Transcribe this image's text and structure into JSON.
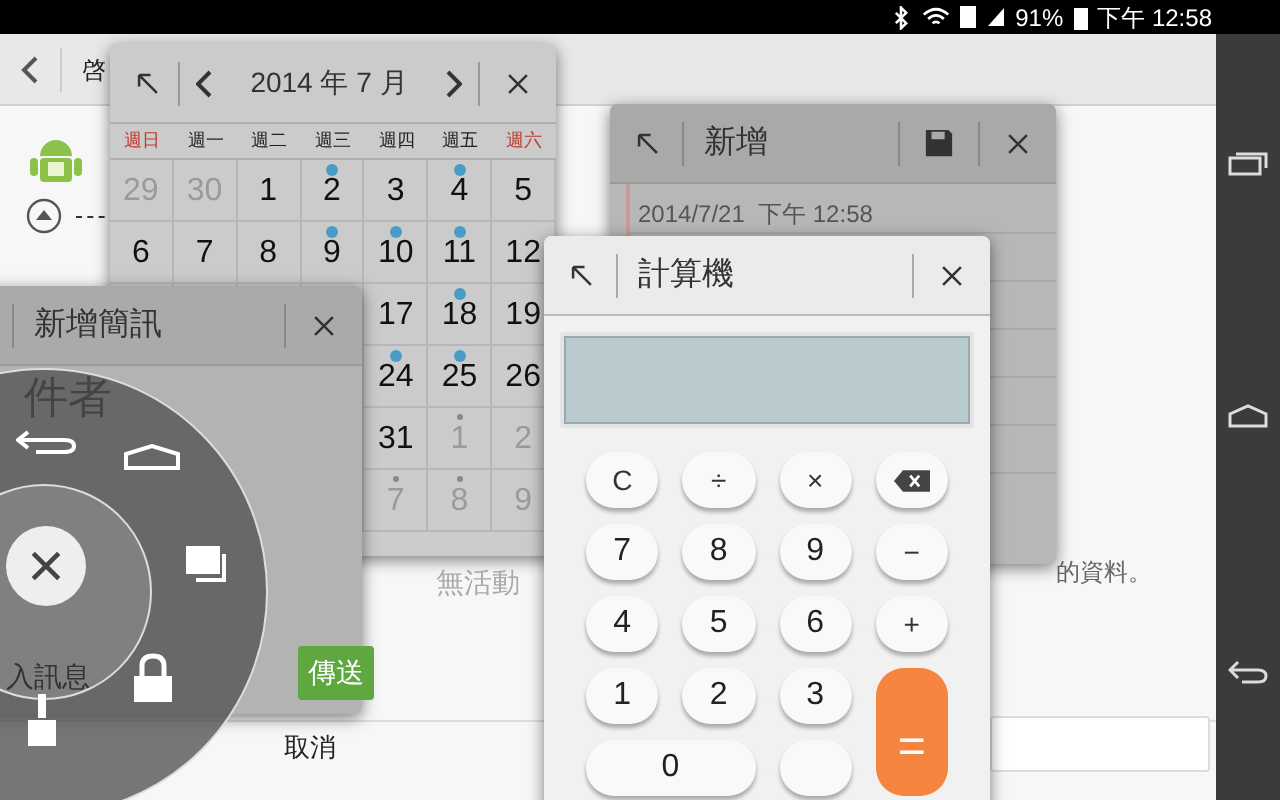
{
  "status_bar": {
    "battery": "91%",
    "time": "下午 12:58"
  },
  "background_app": {
    "title": "啓",
    "texts": [
      "無活動",
      "的資料。"
    ],
    "cancel_button": "取消"
  },
  "calendar_window": {
    "title": "2014 年 7 月",
    "weekdays": [
      {
        "label": "週日",
        "weekend": true
      },
      {
        "label": "週一",
        "weekend": false
      },
      {
        "label": "週二",
        "weekend": false
      },
      {
        "label": "週三",
        "weekend": false
      },
      {
        "label": "週四",
        "weekend": false
      },
      {
        "label": "週五",
        "weekend": false
      },
      {
        "label": "週六",
        "weekend": true
      }
    ],
    "weeks": [
      [
        {
          "day": "29",
          "muted": true,
          "event": false,
          "minor": false
        },
        {
          "day": "30",
          "muted": true,
          "event": false,
          "minor": false
        },
        {
          "day": "1",
          "muted": false,
          "event": false,
          "minor": false
        },
        {
          "day": "2",
          "muted": false,
          "event": true,
          "minor": false
        },
        {
          "day": "3",
          "muted": false,
          "event": false,
          "minor": false
        },
        {
          "day": "4",
          "muted": false,
          "event": true,
          "minor": false
        },
        {
          "day": "5",
          "muted": false,
          "event": false,
          "minor": false
        }
      ],
      [
        {
          "day": "6",
          "muted": false,
          "event": false,
          "minor": false
        },
        {
          "day": "7",
          "muted": false,
          "event": false,
          "minor": false
        },
        {
          "day": "8",
          "muted": false,
          "event": false,
          "minor": false
        },
        {
          "day": "9",
          "muted": false,
          "event": true,
          "minor": false
        },
        {
          "day": "10",
          "muted": false,
          "event": true,
          "minor": false
        },
        {
          "day": "11",
          "muted": false,
          "event": true,
          "minor": false
        },
        {
          "day": "12",
          "muted": false,
          "event": false,
          "minor": false
        }
      ],
      [
        {
          "day": "17",
          "muted": false,
          "event": false,
          "minor": false
        },
        {
          "day": "18",
          "muted": false,
          "event": true,
          "minor": false
        },
        {
          "day": "19",
          "muted": false,
          "event": false,
          "minor": false
        }
      ],
      [
        {
          "day": "24",
          "muted": false,
          "event": true,
          "minor": false
        },
        {
          "day": "25",
          "muted": false,
          "event": true,
          "minor": false
        },
        {
          "day": "26",
          "muted": false,
          "event": false,
          "minor": false
        }
      ],
      [
        {
          "day": "31",
          "muted": false,
          "event": false,
          "minor": false
        },
        {
          "day": "1",
          "muted": true,
          "event": false,
          "minor": true
        },
        {
          "day": "2",
          "muted": true,
          "event": false,
          "minor": false
        }
      ],
      [
        {
          "day": "7",
          "muted": true,
          "event": false,
          "minor": true
        },
        {
          "day": "8",
          "muted": true,
          "event": false,
          "minor": true
        },
        {
          "day": "9",
          "muted": true,
          "event": false,
          "minor": false
        }
      ]
    ]
  },
  "notes_window": {
    "title": "新增",
    "timestamp": "2014/7/21  下午 12:58"
  },
  "sms_window": {
    "title": "新增簡訊",
    "recipient_placeholder": "件者",
    "message_placeholder": "入訊息",
    "send_button": "傳送"
  },
  "calculator_window": {
    "title": "計算機",
    "keys": [
      {
        "label": "C",
        "kind": "function"
      },
      {
        "label": "÷",
        "kind": "function"
      },
      {
        "label": "×",
        "kind": "function"
      },
      {
        "kind": "backspace"
      },
      {
        "label": "7",
        "kind": "digit"
      },
      {
        "label": "8",
        "kind": "digit"
      },
      {
        "label": "9",
        "kind": "digit"
      },
      {
        "label": "−",
        "kind": "function"
      },
      {
        "label": "4",
        "kind": "digit"
      },
      {
        "label": "5",
        "kind": "digit"
      },
      {
        "label": "6",
        "kind": "digit"
      },
      {
        "label": "+",
        "kind": "function"
      },
      {
        "label": "1",
        "kind": "digit"
      },
      {
        "label": "2",
        "kind": "digit"
      },
      {
        "label": "3",
        "kind": "digit"
      },
      {
        "label": "=",
        "kind": "equals"
      },
      {
        "label": "0",
        "kind": "zero"
      },
      {
        "kind": "point"
      }
    ]
  }
}
